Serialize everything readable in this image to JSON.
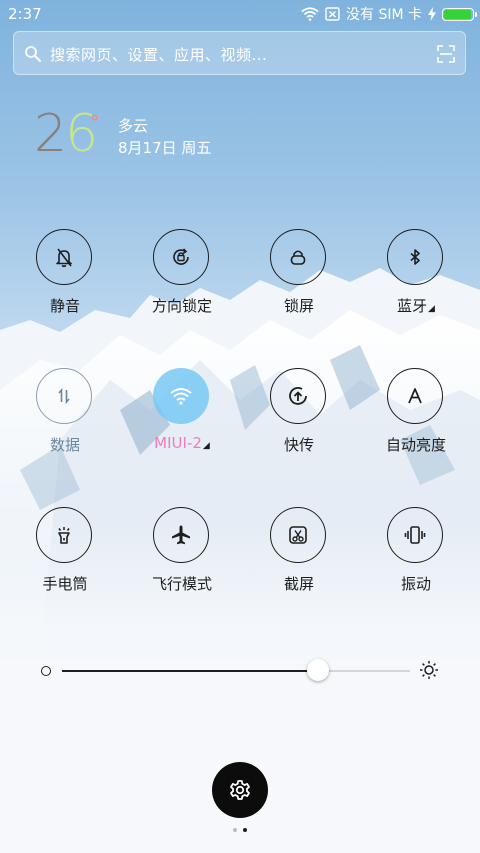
{
  "status_bar": {
    "time": "2:37",
    "sim_text": "没有 SIM 卡",
    "battery_level": 0.95,
    "battery_color": "#35d23a",
    "icons": [
      "wifi-icon",
      "sim-card-icon",
      "charging-icon",
      "battery-icon"
    ]
  },
  "search": {
    "placeholder": "搜索网页、设置、应用、视频...",
    "icons": [
      "search-icon",
      "scan-icon"
    ]
  },
  "weather": {
    "temp_tens": "2",
    "temp_ones": "6",
    "degree_symbol": "°",
    "condition": "多云",
    "date": "8月17日 周五"
  },
  "toggles": [
    {
      "label": "静音",
      "icon": "silent-bell-icon",
      "state": "off",
      "has_more": false
    },
    {
      "label": "方向锁定",
      "icon": "rotation-lock-icon",
      "state": "off",
      "has_more": false
    },
    {
      "label": "锁屏",
      "icon": "lock-icon",
      "state": "off",
      "has_more": false
    },
    {
      "label": "蓝牙",
      "icon": "bluetooth-icon",
      "state": "off",
      "has_more": true
    },
    {
      "label": "数据",
      "icon": "mobile-data-icon",
      "state": "disabled",
      "has_more": false
    },
    {
      "label": "MIUI-2",
      "icon": "wifi-icon",
      "state": "on",
      "has_more": true
    },
    {
      "label": "快传",
      "icon": "quick-transfer-icon",
      "state": "off",
      "has_more": false
    },
    {
      "label": "自动亮度",
      "icon": "auto-brightness-icon",
      "state": "off",
      "has_more": false
    },
    {
      "label": "手电筒",
      "icon": "flashlight-icon",
      "state": "off",
      "has_more": false
    },
    {
      "label": "飞行模式",
      "icon": "airplane-icon",
      "state": "off",
      "has_more": false
    },
    {
      "label": "截屏",
      "icon": "screenshot-icon",
      "state": "off",
      "has_more": false
    },
    {
      "label": "振动",
      "icon": "vibrate-icon",
      "state": "off",
      "has_more": false
    }
  ],
  "brightness": {
    "level": 0.735,
    "icons": [
      "brightness-low-icon",
      "brightness-high-icon"
    ]
  },
  "settings": {
    "icon": "gear-icon"
  },
  "pager": {
    "pages": 2,
    "current": 2
  },
  "colors": {
    "active_toggle_bg": "#78c8f5",
    "active_label": "#f07cc0",
    "icon_dark": "#1e1e1e"
  }
}
